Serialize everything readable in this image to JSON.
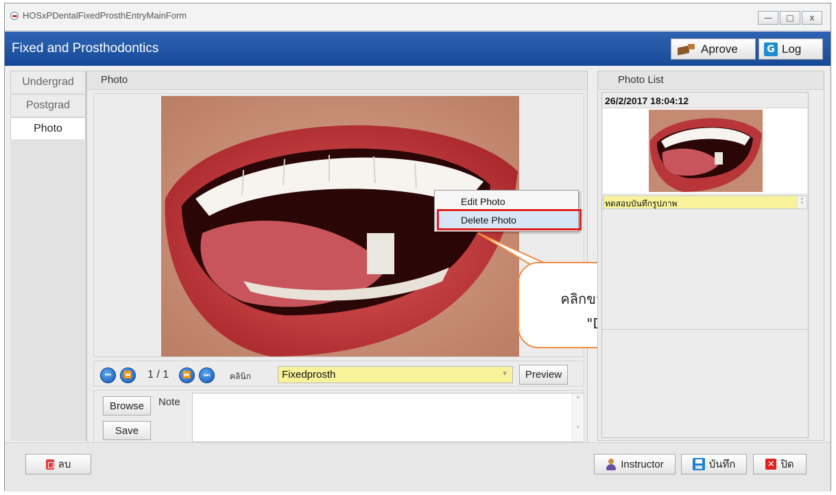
{
  "window": {
    "title": "HOSxPDentalFixedProsthEntryMainForm",
    "controls": {
      "minimize": "—",
      "maximize": "□",
      "close": "x"
    }
  },
  "header": {
    "title": "Fixed and Prosthodontics",
    "approve_label": "Aprove",
    "log_label": "Log",
    "log_icon_glyph": "G"
  },
  "tabs": [
    {
      "label": "Undergrad",
      "active": false
    },
    {
      "label": "Postgrad",
      "active": false
    },
    {
      "label": "Photo",
      "active": true
    }
  ],
  "photo_panel": {
    "caption": "Photo",
    "context_menu": {
      "items": [
        {
          "label": "Edit Photo"
        },
        {
          "label": "Delete Photo",
          "highlighted": true
        }
      ]
    },
    "callout": {
      "line1": "คลิกขวาที่รูปและเลือกเมนู",
      "line2": "\"Delete Photo\""
    },
    "navigator": {
      "first_glyph": "⏮",
      "prev_glyph": "⏪",
      "next_glyph": "⏩",
      "last_glyph": "⏭",
      "page_text": "1 / 1"
    },
    "clinic_label": "คลินิก",
    "clinic_value": "Fixedprosth",
    "preview_label": "Preview",
    "browse_label": "Browse",
    "save_label": "Save",
    "note_label": "Note",
    "note_value": ""
  },
  "photo_list": {
    "caption": "Photo List",
    "items": [
      {
        "timestamp": "26/2/2017 18:04:12",
        "caption": "ทดสอบบันทึกรูปภาพ"
      }
    ]
  },
  "footer": {
    "delete_label": "ลบ",
    "instructor_label": "Instructor",
    "save_label": "บันทึก",
    "close_label": "ปิด",
    "close_glyph": "✕"
  },
  "colors": {
    "header_blue": "#1e56a6",
    "highlight_yellow": "#f8f39a",
    "callout_border": "#f08c43",
    "menu_highlight_border": "#e01f1f",
    "nav_button_blue": "#1a64c0"
  }
}
